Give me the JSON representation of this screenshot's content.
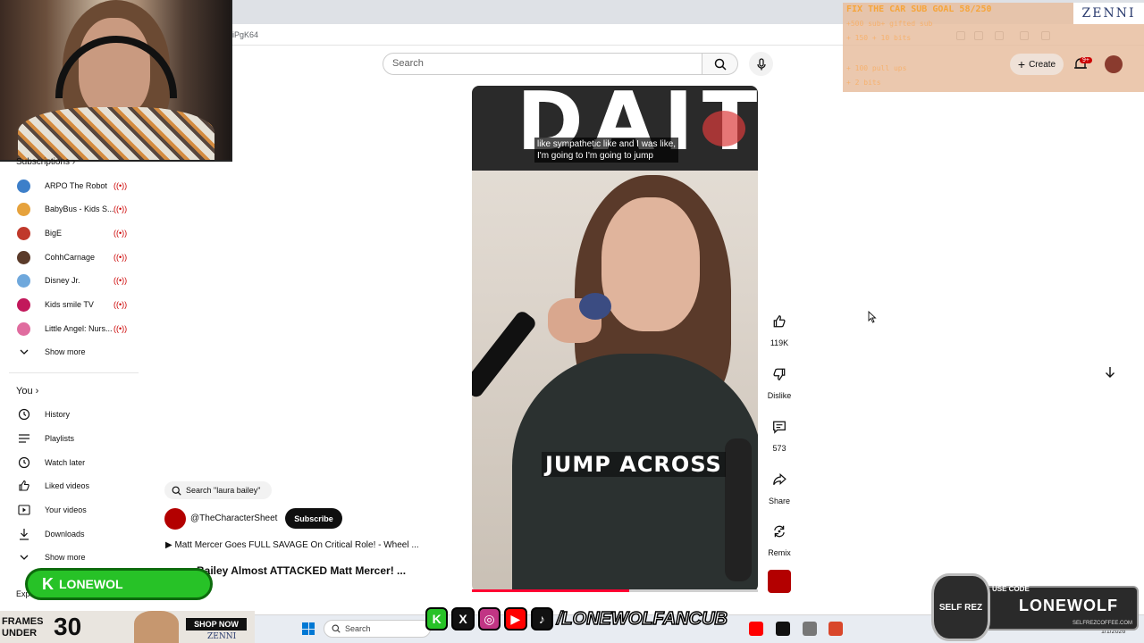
{
  "browser": {
    "url_fragment": "iPgK64"
  },
  "header": {
    "search_placeholder": "Search",
    "create_label": "Create",
    "notification_count": "9+"
  },
  "overlay": {
    "goal_title": "FIX THE CAR SUB GOAL 58/250",
    "zenni_logo": "ZENNI",
    "goal_lines": [
      "+500 sub+ gifted sub",
      "+ 150 + 10 bits",
      "+ 100 pull ups",
      "+ 2 bits"
    ]
  },
  "sidebar": {
    "subscriptions_label": "Subscriptions",
    "subscriptions": [
      {
        "label": "ARPO The Robot",
        "live": "((•))",
        "color": "#3d7fc9"
      },
      {
        "label": "BabyBus - Kids S...",
        "live": "((•))",
        "color": "#e6a23c"
      },
      {
        "label": "BigE",
        "live": "((•))",
        "color": "#c0392b"
      },
      {
        "label": "CohhCarnage",
        "live": "((•))",
        "color": "#5b3b2a"
      },
      {
        "label": "Disney Jr.",
        "live": "((•))",
        "color": "#6fa8dc"
      },
      {
        "label": "Kids smile TV",
        "live": "((•))",
        "color": "#c2185b"
      },
      {
        "label": "Little Angel: Nurs...",
        "live": "((•))",
        "color": "#e06c9f"
      }
    ],
    "show_more_1": "Show more",
    "you_label": "You",
    "you_items": [
      {
        "label": "History",
        "icon": "history-icon"
      },
      {
        "label": "Playlists",
        "icon": "playlists-icon"
      },
      {
        "label": "Watch later",
        "icon": "watch-later-icon"
      },
      {
        "label": "Liked videos",
        "icon": "like-icon"
      },
      {
        "label": "Your videos",
        "icon": "your-videos-icon"
      },
      {
        "label": "Downloads",
        "icon": "download-icon"
      }
    ],
    "show_more_2": "Show more",
    "explore_label": "Expl"
  },
  "description": {
    "search_chip": "Search \"laura bailey\"",
    "channel_handle": "@TheCharacterSheet",
    "subscribe_label": "Subscribe",
    "related_1": "▶ Matt Mercer Goes FULL SAVAGE On Critical Role! - Wheel ...",
    "related_2": "Bailey Almost ATTACKED Matt Mercer! ..."
  },
  "video": {
    "caption_line1": "like sympathetic like and I was like,",
    "caption_line2": "I'm going to I'm going to jump",
    "overlay_text": "JUMP ACROSS",
    "progress": 0.55
  },
  "actions": {
    "like_count": "119K",
    "dislike_label": "Dislike",
    "comment_count": "573",
    "share_label": "Share",
    "remix_label": "Remix"
  },
  "stream": {
    "badge_text": "LONEWOL",
    "frames_text_1": "FRAMES",
    "frames_text_2": "UNDER",
    "price": "30",
    "shop_now": "SHOP NOW",
    "zenni_ad": "ZENNI",
    "social_handle": "/LONEWOLFANCUB",
    "use_code": "USE CODE",
    "code": "LONEWOLF",
    "selfrez_logo": "SELF REZ",
    "selfrez_url": "SELFREZCOFFEE.COM"
  },
  "taskbar": {
    "search_label": "Search",
    "date": "1/1/2026"
  },
  "colors": {
    "accent_red": "#ff0033",
    "live_red": "#cc0000",
    "badge_green": "#27c227"
  }
}
